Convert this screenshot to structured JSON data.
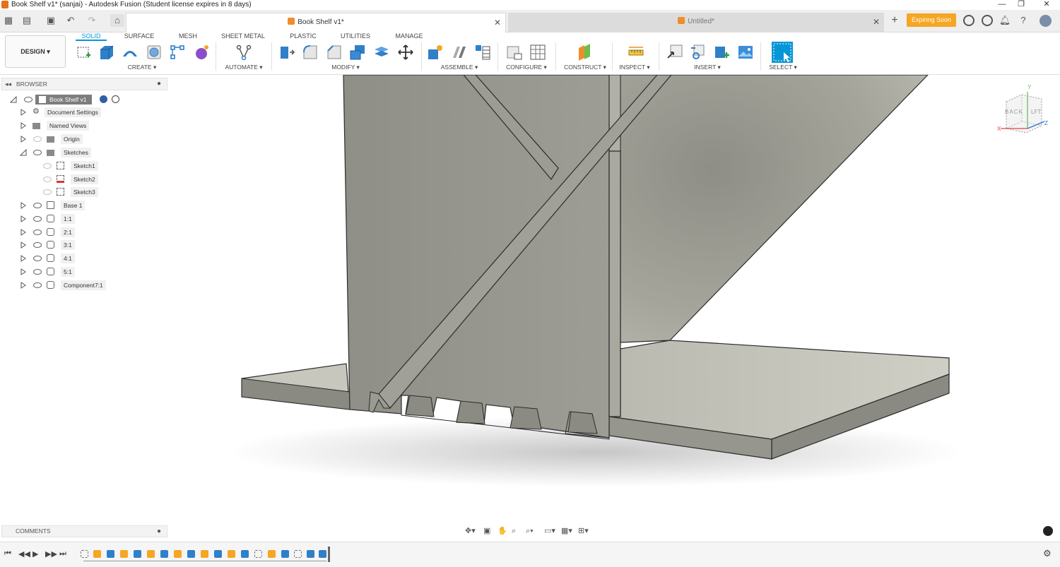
{
  "window": {
    "title": "Book Shelf v1* (sanjai) - Autodesk Fusion (Student license expires in 8 days)",
    "controls": [
      "—",
      "❐",
      "✕"
    ]
  },
  "tabs": [
    {
      "label": "Book Shelf v1*",
      "active": true
    },
    {
      "label": "Untitled*",
      "active": false
    }
  ],
  "header": {
    "expiring_label": "Expiring Soon"
  },
  "toolbar": {
    "design_label": "DESIGN ▾",
    "workspace_tabs": [
      "SOLID",
      "SURFACE",
      "MESH",
      "SHEET METAL",
      "PLASTIC",
      "UTILITIES",
      "MANAGE"
    ],
    "groups": {
      "create": "CREATE ▾",
      "automate": "AUTOMATE ▾",
      "modify": "MODIFY ▾",
      "assemble": "ASSEMBLE ▾",
      "configure": "CONFIGURE ▾",
      "construct": "CONSTRUCT ▾",
      "inspect": "INSPECT ▾",
      "insert": "INSERT ▾",
      "select": "SELECT ▾"
    }
  },
  "browser": {
    "title": "BROWSER",
    "root": "Book Shelf v1",
    "items": [
      {
        "label": "Document Settings",
        "icon": "gear-icon"
      },
      {
        "label": "Named Views",
        "icon": "folder-icon"
      },
      {
        "label": "Origin",
        "icon": "folder-icon"
      },
      {
        "label": "Sketches",
        "icon": "folder-icon"
      },
      {
        "label": "Sketch1",
        "icon": "sketch-icon"
      },
      {
        "label": "Sketch2",
        "icon": "sketch-icon"
      },
      {
        "label": "Sketch3",
        "icon": "sketch-icon"
      },
      {
        "label": "Base 1",
        "icon": "component-icon"
      },
      {
        "label": "1:1",
        "icon": "body-icon"
      },
      {
        "label": "2:1",
        "icon": "body-icon"
      },
      {
        "label": "3:1",
        "icon": "body-icon"
      },
      {
        "label": "4:1",
        "icon": "body-icon"
      },
      {
        "label": "5:1",
        "icon": "body-icon"
      },
      {
        "label": "Component7:1",
        "icon": "body-icon"
      }
    ]
  },
  "comments": {
    "title": "COMMENTS"
  },
  "viewcube": {
    "back": "BACK",
    "left": "LFT",
    "axis_x": "X",
    "axis_y": "Y",
    "axis_z": "Z"
  },
  "colors": {
    "accent": "#0696d7",
    "expiring": "#f5a623",
    "model_face": "#9b9b92"
  }
}
